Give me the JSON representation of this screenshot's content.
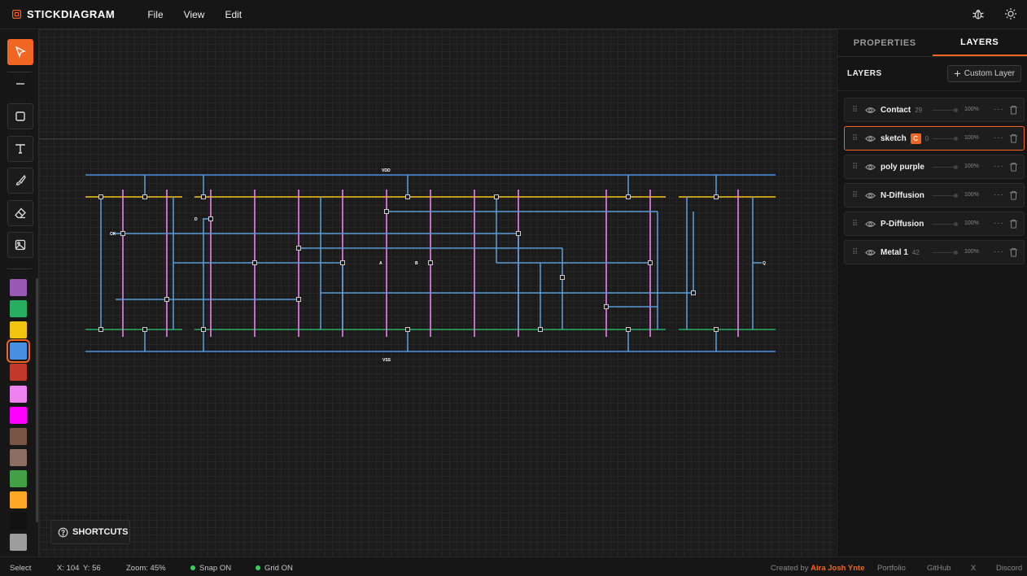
{
  "app": {
    "title": "STICKDIAGRAM",
    "menu": [
      "File",
      "View",
      "Edit"
    ]
  },
  "colors": {
    "accent": "#f26522",
    "vdd_rail": "#4a90e2",
    "polysilicon": "#ee82ee",
    "p_diffusion": "#f5c518",
    "n_diffusion": "#27ae60",
    "metal": "#5b9bd5"
  },
  "toolbar": {
    "tools": [
      "select-tool",
      "line-tool",
      "rectangle-tool",
      "text-tool",
      "brush-tool",
      "eraser-tool",
      "image-tool"
    ],
    "swatches": [
      "#9b59b6",
      "#27ae60",
      "#f1c40f",
      "#4a90e2",
      "#c0392b",
      "#ee82ee",
      "#ff00ff",
      "#795548",
      "#8d6e63",
      "#43a047",
      "#ffa726",
      "#111111",
      "#9e9e9e"
    ],
    "selected_swatch": 3
  },
  "canvas": {
    "labels": {
      "vdd": "VDD",
      "vss": "VSS",
      "d": "D",
      "ck": "CK",
      "a": "A",
      "b": "B",
      "q": "Q"
    }
  },
  "shortcuts": {
    "label": "SHORTCUTS"
  },
  "panel": {
    "tabs": [
      "PROPERTIES",
      "LAYERS"
    ],
    "active_tab": "LAYERS",
    "layers_title": "LAYERS",
    "custom_layer_label": "Custom Layer",
    "layers": [
      {
        "name": "Contact",
        "count": "29",
        "opacity": "100%",
        "active": false,
        "badge": ""
      },
      {
        "name": "sketch",
        "count": "0",
        "opacity": "100%",
        "active": true,
        "badge": "C"
      },
      {
        "name": "poly purple",
        "count": "",
        "opacity": "100%",
        "active": false,
        "badge": ""
      },
      {
        "name": "N-Diffusion",
        "count": "",
        "opacity": "100%",
        "active": false,
        "badge": ""
      },
      {
        "name": "P-Diffusion",
        "count": "",
        "opacity": "100%",
        "active": false,
        "badge": ""
      },
      {
        "name": "Metal 1",
        "count": "42",
        "opacity": "100%",
        "active": false,
        "badge": ""
      }
    ]
  },
  "status": {
    "mode": "Select",
    "x": "X: 104",
    "y": "Y: 56",
    "zoom": "Zoom: 45%",
    "snap": "Snap ON",
    "grid": "Grid ON",
    "created_by": "Created by",
    "author": "Aira Josh Ynte",
    "links": [
      "Portfolio",
      "GitHub",
      "X",
      "Discord"
    ]
  }
}
